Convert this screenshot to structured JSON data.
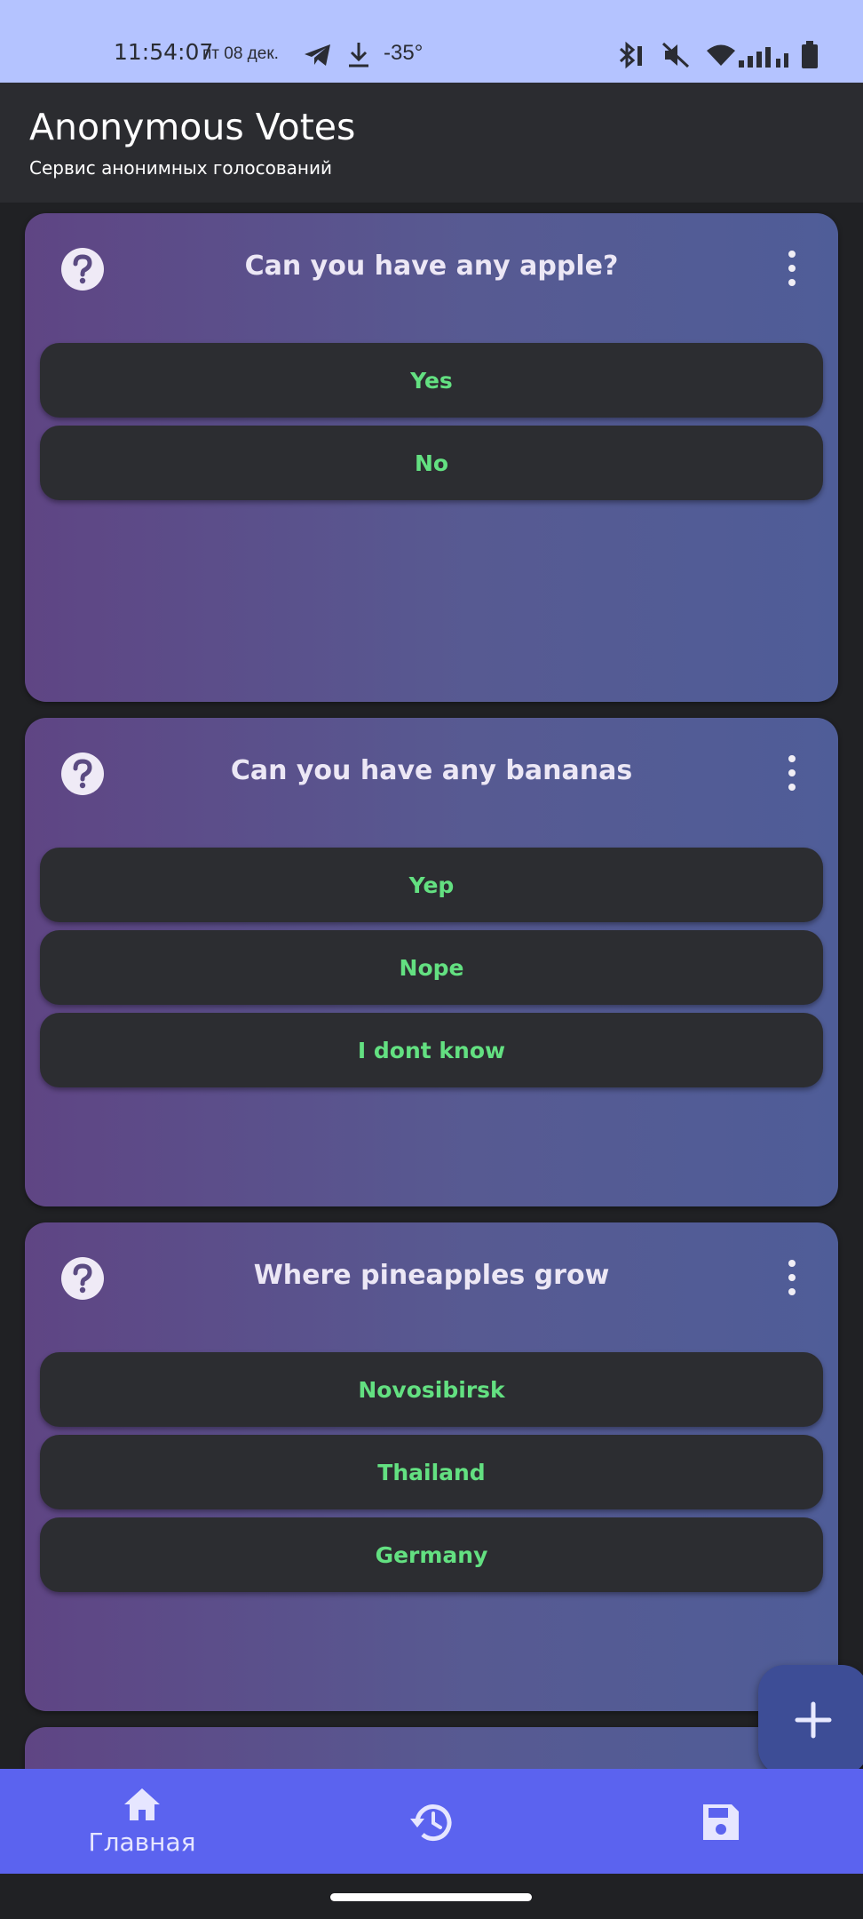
{
  "status_bar": {
    "time": "11:54:07",
    "date": "пт 08 дек.",
    "temperature": "-35°",
    "icons": [
      "telegram-icon",
      "download-icon",
      "bluetooth-icon",
      "mute-icon",
      "wifi-icon",
      "signal-icon",
      "battery-icon"
    ]
  },
  "app_bar": {
    "title": "Anonymous Votes",
    "subtitle": "Сервис анонимных голосований"
  },
  "polls": [
    {
      "question": "Can you have any apple?",
      "options": [
        "Yes",
        "No"
      ]
    },
    {
      "question": "Can you have any bananas",
      "options": [
        "Yep",
        "Nope",
        "I dont know"
      ]
    },
    {
      "question": "Where pineapples grow",
      "options": [
        "Novosibirsk",
        "Thailand",
        "Germany"
      ]
    }
  ],
  "fab": {
    "icon": "plus-icon"
  },
  "bottom_nav": {
    "items": [
      {
        "label": "Главная",
        "icon": "home-icon"
      },
      {
        "label": "",
        "icon": "history-icon"
      },
      {
        "label": "",
        "icon": "save-icon"
      }
    ]
  },
  "colors": {
    "status_bar": "#b4c3ff",
    "app_bar": "#2b2c30",
    "card_gradient_start": "#5f4584",
    "card_gradient_end": "#4f5d98",
    "option_bg": "#2c2d31",
    "option_text": "#63e081",
    "bottom_nav": "#5b63ef",
    "fab": "#3d4d96"
  }
}
